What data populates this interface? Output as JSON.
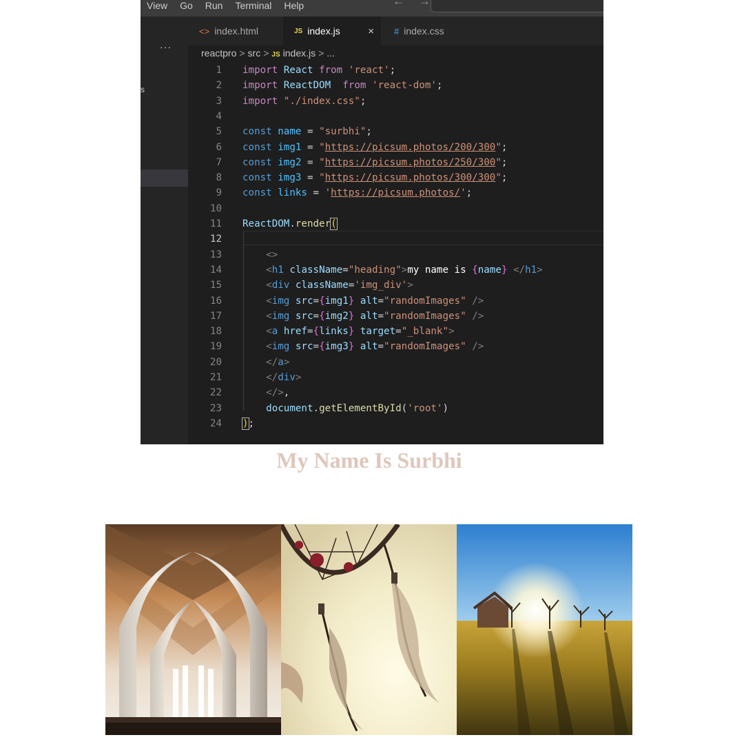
{
  "menu": {
    "items": [
      "View",
      "Go",
      "Run",
      "Terminal",
      "Help"
    ],
    "nav_arrows": "← →"
  },
  "sidebar": {
    "overflow": "···",
    "fragment": "s"
  },
  "tabs": [
    {
      "label": "index.html",
      "icon": "html-file-icon",
      "active": false
    },
    {
      "label": "index.js",
      "icon": "js-file-icon",
      "active": true
    },
    {
      "label": "index.css",
      "icon": "css-file-icon",
      "active": false
    }
  ],
  "tab_icons": {
    "html": "<>",
    "js": "JS",
    "css": "#",
    "close": "×"
  },
  "breadcrumb": {
    "project": "reactpro",
    "folder": "src",
    "file": "index.js",
    "more": "...",
    "separator": ">"
  },
  "editor": {
    "active_line": 12,
    "line_numbers": [
      "1",
      "2",
      "3",
      "4",
      "5",
      "6",
      "7",
      "8",
      "9",
      "10",
      "11",
      "12",
      "13",
      "14",
      "15",
      "16",
      "17",
      "18",
      "19",
      "20",
      "21",
      "22",
      "23",
      "24"
    ],
    "lines": [
      [
        [
          "kw-ctrl",
          "import"
        ],
        [
          "plain",
          " "
        ],
        [
          "var",
          "React"
        ],
        [
          "plain",
          " "
        ],
        [
          "kw-ctrl",
          "from"
        ],
        [
          "plain",
          " "
        ],
        [
          "str",
          "'react'"
        ],
        [
          "plain",
          ";"
        ]
      ],
      [
        [
          "kw-ctrl",
          "import"
        ],
        [
          "plain",
          " "
        ],
        [
          "var",
          "ReactDOM"
        ],
        [
          "plain",
          "  "
        ],
        [
          "kw-ctrl",
          "from"
        ],
        [
          "plain",
          " "
        ],
        [
          "str",
          "'react-dom'"
        ],
        [
          "plain",
          ";"
        ]
      ],
      [
        [
          "kw-ctrl",
          "import"
        ],
        [
          "plain",
          " "
        ],
        [
          "str",
          "\"./index.css\""
        ],
        [
          "plain",
          ";"
        ]
      ],
      [],
      [
        [
          "kw",
          "const"
        ],
        [
          "plain",
          " "
        ],
        [
          "cst",
          "name"
        ],
        [
          "plain",
          " = "
        ],
        [
          "str",
          "\"surbhi\""
        ],
        [
          "plain",
          ";"
        ]
      ],
      [
        [
          "kw",
          "const"
        ],
        [
          "plain",
          " "
        ],
        [
          "cst",
          "img1"
        ],
        [
          "plain",
          " = "
        ],
        [
          "str",
          "\""
        ],
        [
          "url",
          "https://picsum.photos/200/300"
        ],
        [
          "str",
          "\""
        ],
        [
          "plain",
          ";"
        ]
      ],
      [
        [
          "kw",
          "const"
        ],
        [
          "plain",
          " "
        ],
        [
          "cst",
          "img2"
        ],
        [
          "plain",
          " = "
        ],
        [
          "str",
          "\""
        ],
        [
          "url",
          "https://picsum.photos/250/300"
        ],
        [
          "str",
          "\""
        ],
        [
          "plain",
          ";"
        ]
      ],
      [
        [
          "kw",
          "const"
        ],
        [
          "plain",
          " "
        ],
        [
          "cst",
          "img3"
        ],
        [
          "plain",
          " = "
        ],
        [
          "str",
          "\""
        ],
        [
          "url",
          "https://picsum.photos/300/300"
        ],
        [
          "str",
          "\""
        ],
        [
          "plain",
          ";"
        ]
      ],
      [
        [
          "kw",
          "const"
        ],
        [
          "plain",
          " "
        ],
        [
          "cst",
          "links"
        ],
        [
          "plain",
          " = "
        ],
        [
          "str",
          "'"
        ],
        [
          "url",
          "https://picsum.photos/"
        ],
        [
          "str",
          "'"
        ],
        [
          "plain",
          ";"
        ]
      ],
      [],
      [
        [
          "var",
          "ReactDOM"
        ],
        [
          "plain",
          "."
        ],
        [
          "fn",
          "render"
        ],
        [
          "bracket-match",
          "("
        ]
      ],
      [],
      [
        [
          "plain",
          "    "
        ],
        [
          "pun",
          "<>"
        ]
      ],
      [
        [
          "plain",
          "    "
        ],
        [
          "pun",
          "<"
        ],
        [
          "tag",
          "h1"
        ],
        [
          "plain",
          " "
        ],
        [
          "var",
          "className"
        ],
        [
          "plain",
          "="
        ],
        [
          "str",
          "\"heading\""
        ],
        [
          "pun",
          ">"
        ],
        [
          "txt",
          "my name is "
        ],
        [
          "brace",
          "{"
        ],
        [
          "var",
          "name"
        ],
        [
          "brace",
          "}"
        ],
        [
          "txt",
          " "
        ],
        [
          "pun",
          "</"
        ],
        [
          "tag",
          "h1"
        ],
        [
          "pun",
          ">"
        ]
      ],
      [
        [
          "plain",
          "    "
        ],
        [
          "pun",
          "<"
        ],
        [
          "tag",
          "div"
        ],
        [
          "plain",
          " "
        ],
        [
          "var",
          "className"
        ],
        [
          "plain",
          "="
        ],
        [
          "str",
          "'img_div'"
        ],
        [
          "pun",
          ">"
        ]
      ],
      [
        [
          "plain",
          "    "
        ],
        [
          "pun",
          "<"
        ],
        [
          "tag",
          "img"
        ],
        [
          "plain",
          " "
        ],
        [
          "var",
          "src"
        ],
        [
          "plain",
          "="
        ],
        [
          "brace",
          "{"
        ],
        [
          "var",
          "img1"
        ],
        [
          "brace",
          "}"
        ],
        [
          "plain",
          " "
        ],
        [
          "var",
          "alt"
        ],
        [
          "plain",
          "="
        ],
        [
          "str",
          "\"randomImages\""
        ],
        [
          "plain",
          " "
        ],
        [
          "pun",
          "/>"
        ]
      ],
      [
        [
          "plain",
          "    "
        ],
        [
          "pun",
          "<"
        ],
        [
          "tag",
          "img"
        ],
        [
          "plain",
          " "
        ],
        [
          "var",
          "src"
        ],
        [
          "plain",
          "="
        ],
        [
          "brace",
          "{"
        ],
        [
          "var",
          "img2"
        ],
        [
          "brace",
          "}"
        ],
        [
          "plain",
          " "
        ],
        [
          "var",
          "alt"
        ],
        [
          "plain",
          "="
        ],
        [
          "str",
          "\"randomImages\""
        ],
        [
          "plain",
          " "
        ],
        [
          "pun",
          "/>"
        ]
      ],
      [
        [
          "plain",
          "    "
        ],
        [
          "pun",
          "<"
        ],
        [
          "tag",
          "a"
        ],
        [
          "plain",
          " "
        ],
        [
          "var",
          "href"
        ],
        [
          "plain",
          "="
        ],
        [
          "brace",
          "{"
        ],
        [
          "var",
          "links"
        ],
        [
          "brace",
          "}"
        ],
        [
          "plain",
          " "
        ],
        [
          "var",
          "target"
        ],
        [
          "plain",
          "="
        ],
        [
          "str",
          "\"_blank\""
        ],
        [
          "pun",
          ">"
        ]
      ],
      [
        [
          "plain",
          "    "
        ],
        [
          "pun",
          "<"
        ],
        [
          "tag",
          "img"
        ],
        [
          "plain",
          " "
        ],
        [
          "var",
          "src"
        ],
        [
          "plain",
          "="
        ],
        [
          "brace",
          "{"
        ],
        [
          "var",
          "img3"
        ],
        [
          "brace",
          "}"
        ],
        [
          "plain",
          " "
        ],
        [
          "var",
          "alt"
        ],
        [
          "plain",
          "="
        ],
        [
          "str",
          "\"randomImages\""
        ],
        [
          "plain",
          " "
        ],
        [
          "pun",
          "/>"
        ]
      ],
      [
        [
          "plain",
          "    "
        ],
        [
          "pun",
          "</"
        ],
        [
          "tag",
          "a"
        ],
        [
          "pun",
          ">"
        ]
      ],
      [
        [
          "plain",
          "    "
        ],
        [
          "pun",
          "</"
        ],
        [
          "tag",
          "div"
        ],
        [
          "pun",
          ">"
        ]
      ],
      [
        [
          "plain",
          "    "
        ],
        [
          "pun",
          "</>"
        ],
        [
          "plain",
          ","
        ]
      ],
      [
        [
          "plain",
          "    "
        ],
        [
          "var",
          "document"
        ],
        [
          "plain",
          "."
        ],
        [
          "fn",
          "getElementById"
        ],
        [
          "plain",
          "("
        ],
        [
          "str",
          "'root'"
        ],
        [
          "plain",
          ")"
        ]
      ],
      [
        [
          "bracket-match",
          ")"
        ],
        [
          "plain",
          ";"
        ]
      ]
    ]
  },
  "rendered": {
    "heading": "my name is surbhi",
    "images": [
      {
        "alt": "randomImages",
        "subject": "cathedral-interior"
      },
      {
        "alt": "randomImages",
        "subject": "dreamcatcher"
      },
      {
        "alt": "randomImages",
        "subject": "sunlit-meadow",
        "linked": true
      }
    ]
  }
}
